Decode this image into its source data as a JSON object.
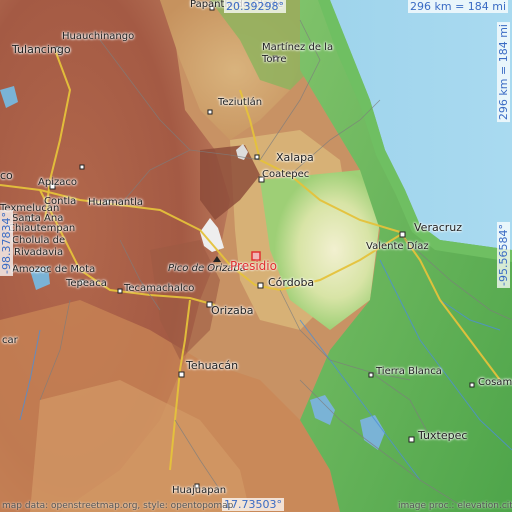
{
  "map": {
    "marker": {
      "label": "Presidio",
      "color": "#e03030"
    },
    "coords": {
      "lat_top": "20.39298°",
      "lat_bottom": "17.73503°",
      "lon_left": "-98.37834°",
      "lon_right": "-95.56584°",
      "scale_horizontal": "296 km = 184 mi",
      "scale_vertical": "296 km = 184 mi"
    },
    "footer": {
      "left": "map data: openstreetmap.org, style: opentopomap",
      "right": "image proc.: elevation.city"
    },
    "places": {
      "papantla": "Papantla de Olarte",
      "huauchinango": "Huauchinango",
      "tulancingo": "Tulancingo",
      "martinez": "Martínez de la Torre",
      "teziutlan": "Teziutlán",
      "xalapa": "Xalapa",
      "coatepec": "Coatepec",
      "pachuca_partial": "co",
      "apizaco": "Apizaco",
      "huamantla": "Huamantla",
      "texmelucan": "Texmelucan",
      "contla": "Contla",
      "santa_ana": "Santa Ana",
      "chiautempan": "Chiautempan",
      "cholula": "Cholula de",
      "rivadavia": "Rivadavia",
      "amozoc": "Amozoc de Mota",
      "tepeaca": "Tepeaca",
      "tecamachalco": "Tecamachalco",
      "pico": "Pico de Orizaba",
      "orizaba": "Orizaba",
      "cordoba": "Córdoba",
      "veracruz": "Veracruz",
      "valente": "Valente Díaz",
      "tehuacan": "Tehuacán",
      "tierra_blanca": "Tierra Blanca",
      "cosamaloapan_partial": "Cosama",
      "tuxtepec": "Tuxtepec",
      "huajuapan": "Huajuapan",
      "atlixco_partial": "car"
    }
  }
}
